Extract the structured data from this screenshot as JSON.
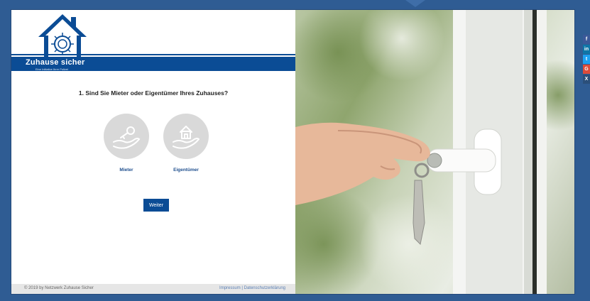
{
  "brand": {
    "name": "Zuhause sicher",
    "tagline": "Eine Initiative Ihrer Polizei"
  },
  "question": "1. Sind Sie Mieter oder Eigentümer Ihres Zuhauses?",
  "options": [
    {
      "label": "Mieter",
      "icon": "key-hand-icon"
    },
    {
      "label": "Eigentümer",
      "icon": "house-hand-icon"
    }
  ],
  "next_button": "Weiter",
  "footer": {
    "copyright": "© 2019 by Netzwerk Zuhause Sicher",
    "impressum": "Impressum",
    "separator": "|",
    "privacy": "Datenschutzerklärung"
  },
  "social": [
    {
      "glyph": "f",
      "color": "#3b5998"
    },
    {
      "glyph": "in",
      "color": "#0e76a8"
    },
    {
      "glyph": "t",
      "color": "#1da1f2"
    },
    {
      "glyph": "G",
      "color": "#dd4b39"
    },
    {
      "glyph": "X",
      "color": "#2b4f7a"
    }
  ],
  "colors": {
    "brand_blue": "#0b4c95",
    "frame_blue": "#2f5c93",
    "circle_grey": "#d9d9d9"
  }
}
